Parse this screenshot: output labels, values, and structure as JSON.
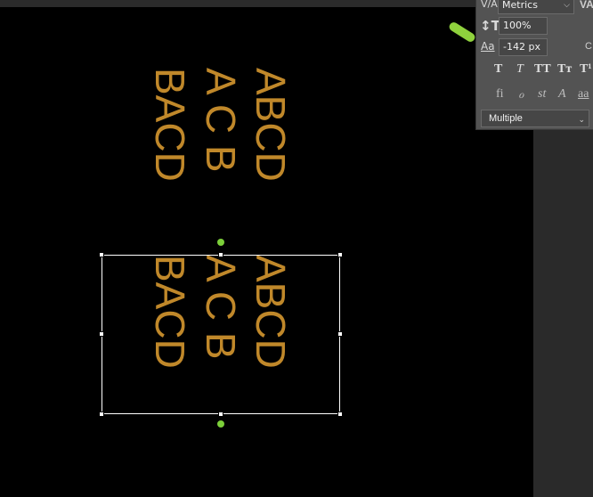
{
  "canvas": {
    "text_color": "#c0882a",
    "top_group": {
      "col1": "BACD",
      "col2": "A C B",
      "col3": "ABCD"
    },
    "bottom_group": {
      "col1": "BACD",
      "col2": "A C B",
      "col3": "ABCD"
    }
  },
  "character_panel": {
    "kerning_label": "V/A",
    "kerning_value": "Metrics",
    "vertical_scale_value": "100%",
    "baseline_shift_label": "Aa",
    "baseline_shift_value": "-142 px",
    "right_edge_label_top": "VA",
    "right_edge_label_mid": "C",
    "style_buttons": [
      "T",
      "T",
      "TT",
      "Tт",
      "T¹"
    ],
    "opentype_buttons": [
      "fi",
      "ℴ",
      "st",
      "A",
      "aa"
    ],
    "language_value": "Multiple"
  },
  "colors": {
    "accent_green": "#7ccf3a",
    "panel_bg": "#535353",
    "selection_box": "#ffffff"
  }
}
